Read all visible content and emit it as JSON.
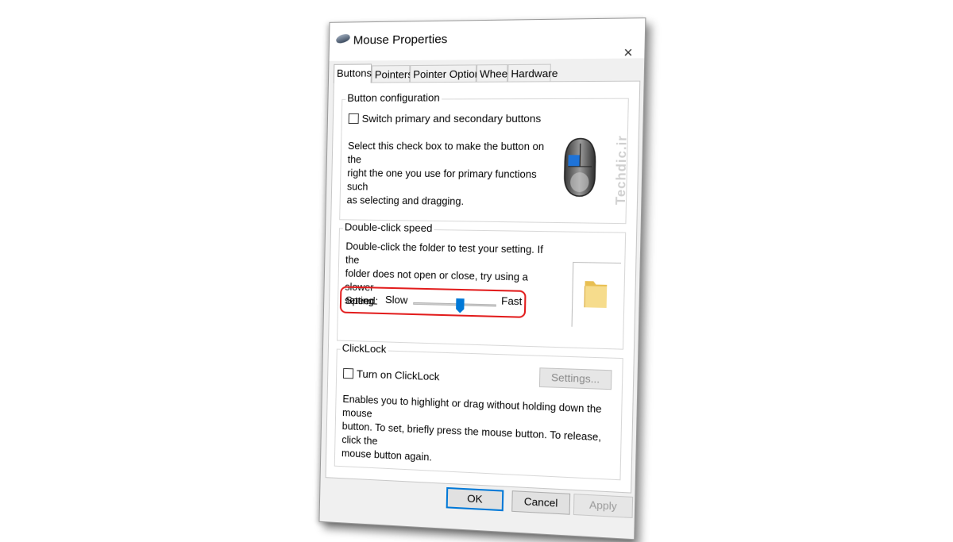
{
  "window": {
    "title": "Mouse Properties",
    "close_glyph": "×"
  },
  "tabs": [
    {
      "label": "Buttons",
      "active": true
    },
    {
      "label": "Pointers",
      "active": false
    },
    {
      "label": "Pointer Options",
      "active": false
    },
    {
      "label": "Wheel",
      "active": false
    },
    {
      "label": "Hardware",
      "active": false
    }
  ],
  "button_configuration": {
    "title": "Button configuration",
    "checkbox_label": "Switch primary and secondary buttons",
    "checked": false,
    "description_lines": [
      "Select this check box to make the button on the",
      "right the one you use for primary functions such",
      "as selecting and dragging."
    ]
  },
  "double_click_speed": {
    "title": "Double-click speed",
    "description_lines": [
      "Double-click the folder to test your setting. If the",
      "folder does not open or close, try using a slower",
      "setting."
    ],
    "speed_label": "Speed:",
    "slow_label": "Slow",
    "fast_label": "Fast",
    "slider_value": 0.58
  },
  "clicklock": {
    "title": "ClickLock",
    "checkbox_label": "Turn on ClickLock",
    "checked": false,
    "settings_button": "Settings...",
    "description_lines": [
      "Enables you to highlight or drag without holding down the mouse",
      "button. To set, briefly press the mouse button. To release, click the",
      "mouse button again."
    ]
  },
  "footer": {
    "ok": "OK",
    "cancel": "Cancel",
    "apply": "Apply"
  },
  "watermark": "Techdic.ir",
  "colors": {
    "accent": "#0078d7",
    "highlight_box": "#e21c1c",
    "folder": "#f2d37a"
  },
  "icons": {
    "title": "mouse-icon",
    "close": "close-icon",
    "mouse_preview": "mouse-illustration-icon",
    "folder": "folder-icon"
  }
}
